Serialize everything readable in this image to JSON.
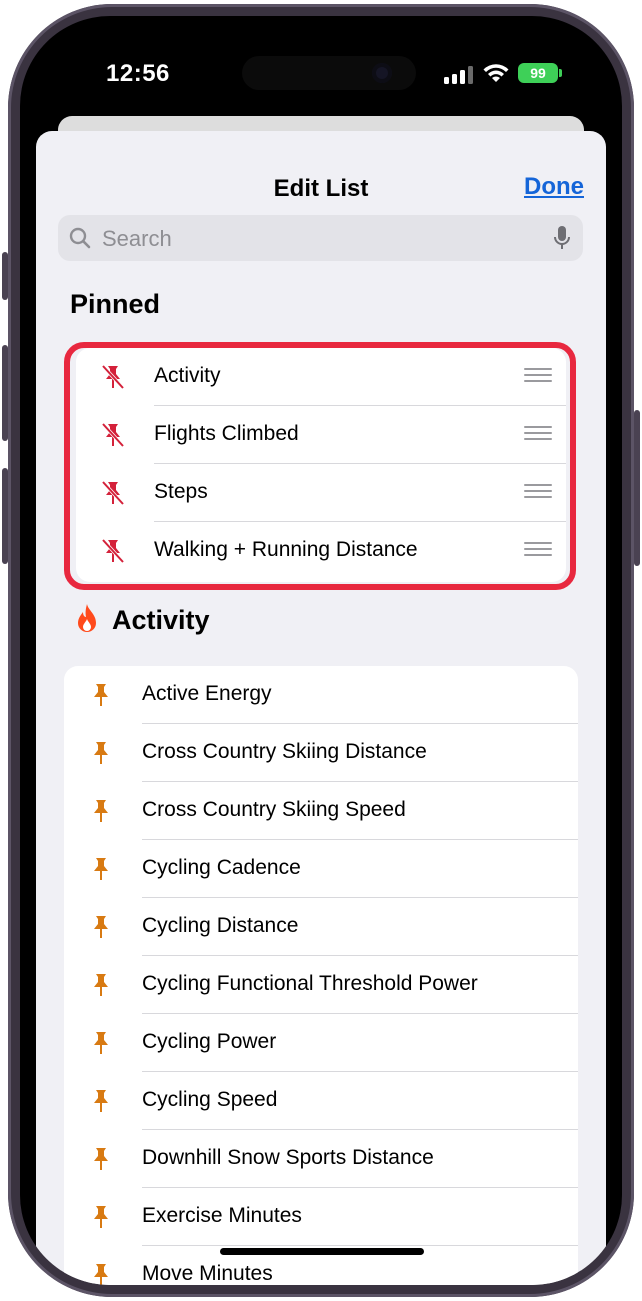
{
  "status_bar": {
    "time": "12:56",
    "battery": "99"
  },
  "nav": {
    "title": "Edit List",
    "done_label": "Done"
  },
  "search": {
    "placeholder": "Search"
  },
  "pinned": {
    "title": "Pinned",
    "items": [
      {
        "label": "Activity"
      },
      {
        "label": "Flights Climbed"
      },
      {
        "label": "Steps"
      },
      {
        "label": "Walking + Running Distance"
      }
    ]
  },
  "activity": {
    "title": "Activity",
    "items": [
      {
        "label": "Active Energy"
      },
      {
        "label": "Cross Country Skiing Distance"
      },
      {
        "label": "Cross Country Skiing Speed"
      },
      {
        "label": "Cycling Cadence"
      },
      {
        "label": "Cycling Distance"
      },
      {
        "label": "Cycling Functional Threshold Power"
      },
      {
        "label": "Cycling Power"
      },
      {
        "label": "Cycling Speed"
      },
      {
        "label": "Downhill Snow Sports Distance"
      },
      {
        "label": "Exercise Minutes"
      },
      {
        "label": "Move Minutes"
      }
    ]
  },
  "colors": {
    "accent": "#1565d8",
    "highlight": "#e8283f",
    "unpin": "#d4213a",
    "pin": "#d87a12",
    "flame": "#ff4a1c"
  }
}
